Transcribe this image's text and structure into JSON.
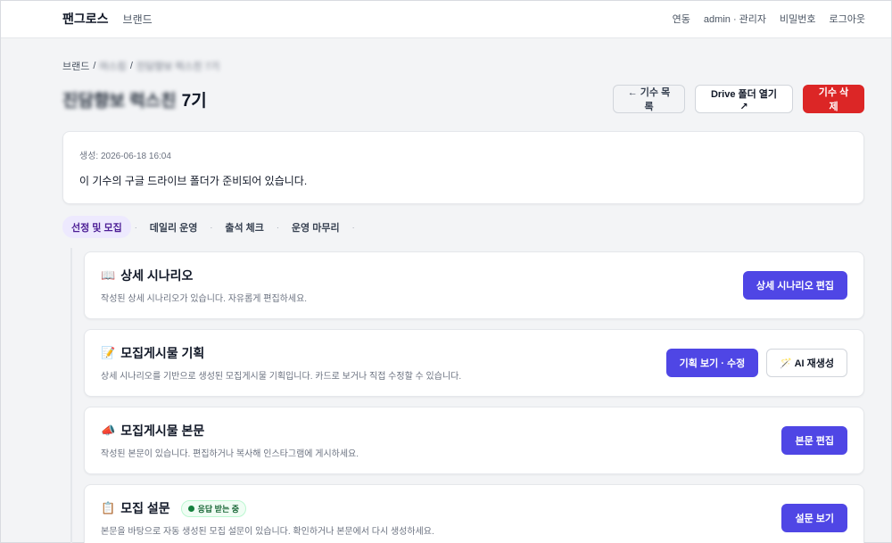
{
  "nav": {
    "brand": "팬그로스",
    "brand_link": "브랜드",
    "links": [
      "연동",
      "admin · 관리자",
      "비밀번호",
      "로그아웃"
    ]
  },
  "breadcrumb": {
    "root": "브랜드",
    "sep": "/",
    "level2": "마스킹",
    "level3": "진담향보 럭스친 7기"
  },
  "page": {
    "title_blurred": "진담향보 럭스친",
    "title_suffix": "7기",
    "buttons": {
      "back": "← 기수 목록",
      "drive": "Drive 폴더 열기 ↗",
      "delete": "기수 삭제"
    }
  },
  "info": {
    "created": "생성: 2026-06-18 16:04",
    "message": "이 기수의 구글 드라이브 폴더가 준비되어 있습니다."
  },
  "tabs": [
    {
      "label": "선정 및 모집",
      "active": true
    },
    {
      "label": "데일리 운영",
      "active": false
    },
    {
      "label": "출석 체크",
      "active": false
    },
    {
      "label": "운영 마무리",
      "active": false
    }
  ],
  "tab_sep": "·",
  "steps": [
    {
      "icon": "📖",
      "icon_name": "book-icon",
      "title": "상세 시나리오",
      "desc": "작성된 상세 시나리오가 있습니다. 자유롭게 편집하세요.",
      "buttons": [
        {
          "label": "상세 시나리오 편집",
          "style": "primary"
        }
      ]
    },
    {
      "icon": "📝",
      "icon_name": "memo-icon",
      "title": "모집게시물 기획",
      "desc": "상세 시나리오를 기반으로 생성된 모집게시물 기획입니다. 카드로 보거나 직접 수정할 수 있습니다.",
      "buttons": [
        {
          "label": "기획 보기 · 수정",
          "style": "primary"
        },
        {
          "label": "🪄 AI 재생성",
          "style": "outline"
        }
      ]
    },
    {
      "icon": "📣",
      "icon_name": "megaphone-icon",
      "title": "모집게시물 본문",
      "desc": "작성된 본문이 있습니다. 편집하거나 복사해 인스타그램에 게시하세요.",
      "buttons": [
        {
          "label": "본문 편집",
          "style": "primary"
        }
      ]
    },
    {
      "icon": "📋",
      "icon_name": "clipboard-icon",
      "title": "모집 설문",
      "badge": "응답 받는 중",
      "desc": "본문을 바탕으로 자동 생성된 모집 설문이 있습니다. 확인하거나 본문에서 다시 생성하세요.",
      "buttons": [
        {
          "label": "설문 보기",
          "style": "primary"
        }
      ]
    }
  ]
}
